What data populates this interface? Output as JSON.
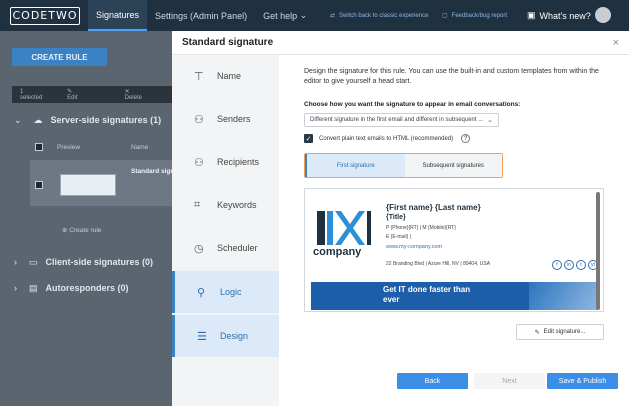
{
  "topbar": {
    "logo": "CODETWO",
    "nav": [
      "Signatures",
      "Settings (Admin Panel)",
      "Get help"
    ],
    "get_help_chevron": "⌄",
    "switch_link": "Switch back to classic experience",
    "feedback_link": "Feedback/bug report",
    "whats_new": "What's new?"
  },
  "background": {
    "create_rule": "CREATE RULE",
    "toolbar": {
      "selected": "1 selected",
      "edit": "Edit",
      "delete": "Delete"
    },
    "server_side": "Server-side signatures (1)",
    "col_preview": "Preview",
    "col_name": "Name",
    "row_name": "Standard sign",
    "create_rule_link": "Create rule",
    "client_side": "Client-side signatures (0)",
    "autoresponders": "Autoresponders (0)"
  },
  "modal": {
    "title": "Standard signature",
    "close": "×",
    "side_nav": [
      {
        "label": "Name",
        "icon": "signpost-icon",
        "glyph": "⊤"
      },
      {
        "label": "Senders",
        "icon": "senders-icon",
        "glyph": "⚇"
      },
      {
        "label": "Recipients",
        "icon": "recipients-icon",
        "glyph": "⚇"
      },
      {
        "label": "Keywords",
        "icon": "keywords-icon",
        "glyph": "⌗"
      },
      {
        "label": "Scheduler",
        "icon": "clock-icon",
        "glyph": "◷"
      },
      {
        "label": "Logic",
        "icon": "logic-icon",
        "glyph": "⚲"
      },
      {
        "label": "Design",
        "icon": "design-icon",
        "glyph": "☰"
      }
    ],
    "description": "Design the signature for this rule. You can use the built-in and custom templates from within the editor to give yourself a head start.",
    "question": "Choose how you want the signature to appear in email conversations:",
    "select_value": "Different signature in the first email and different in subsequent ...",
    "convert_label": "Convert plain text emails to HTML (recommended)",
    "tabs": [
      "First signature",
      "Subsequent signatures"
    ],
    "signature": {
      "company": "company",
      "name": "{First name} {Last name}",
      "title": "{Title}",
      "phone_line": "P {Phone}{RT} | M {Mobile}{RT}",
      "email_line": "E {E-mail} |",
      "website": "www.my-company.com",
      "address": "22 Branding Blvd | Azure Hill, NV | 89404, USA",
      "socials": [
        "f",
        "in",
        "t",
        "yt"
      ],
      "banner": "Get IT done faster than ever"
    },
    "edit_button": "Edit signature...",
    "buttons": {
      "back": "Back",
      "next": "Next",
      "save": "Save & Publish"
    }
  },
  "colors": {
    "accent": "#3c8ee6",
    "topbar": "#1f3040",
    "tab_highlight": "#f0a250"
  }
}
